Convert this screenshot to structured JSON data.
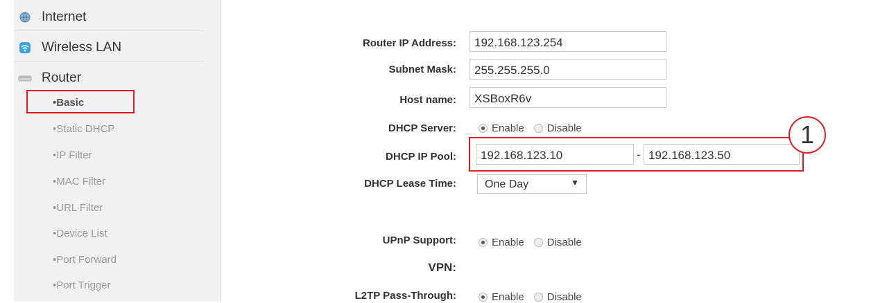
{
  "sidebar": {
    "items": [
      {
        "label": "Internet",
        "icon": "globe-icon"
      },
      {
        "label": "Wireless LAN",
        "icon": "wifi-icon"
      },
      {
        "label": "Router",
        "icon": "router-icon"
      }
    ],
    "router_sub": [
      "•Basic",
      "•Static DHCP",
      "•IP Filter",
      "•MAC Filter",
      "•URL Filter",
      "•Device List",
      "•Port Forward",
      "•Port Trigger"
    ]
  },
  "form": {
    "router_ip_label": "Router IP Address:",
    "router_ip_value": "192.168.123.254",
    "subnet_label": "Subnet Mask:",
    "subnet_value": "255.255.255.0",
    "host_label": "Host name:",
    "host_value": "XSBoxR6v",
    "dhcp_server_label": "DHCP Server:",
    "enable": "Enable",
    "disable": "Disable",
    "dhcp_pool_label": "DHCP IP Pool:",
    "pool_start": "192.168.123.10",
    "pool_sep": "-",
    "pool_end": "192.168.123.50",
    "lease_label": "DHCP Lease Time:",
    "lease_value": "One Day",
    "upnp_label": "UPnP Support:",
    "vpn_label": "VPN:",
    "l2tp_label": "L2TP Pass-Through:"
  },
  "annotation": {
    "marker": "1"
  },
  "colors": {
    "highlight": "#e21b23",
    "sidebar_bg": "#f1f1f1"
  }
}
